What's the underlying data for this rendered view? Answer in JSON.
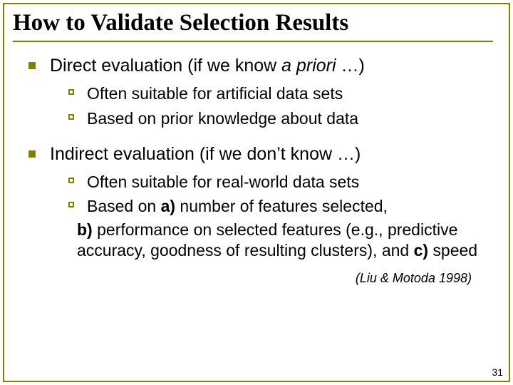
{
  "title": "How to Validate Selection Results",
  "topics": [
    {
      "heading_prefix": "Direct evaluation (if we know ",
      "heading_italic": "a priori",
      "heading_suffix": " …)",
      "subs": [
        {
          "line": "Often suitable for artificial data sets"
        },
        {
          "line": "Based on prior knowledge about data"
        }
      ]
    },
    {
      "heading_prefix": "Indirect evaluation (if we don’t know …)",
      "heading_italic": "",
      "heading_suffix": "",
      "subs": [
        {
          "line": "Often suitable for real-world data sets"
        },
        {
          "parts": [
            {
              "bold": false,
              "text": "Based on "
            },
            {
              "bold": true,
              "text": "a)"
            },
            {
              "bold": false,
              "text": " number of features selected, "
            }
          ],
          "cont": [
            [
              {
                "bold": true,
                "text": "b)"
              },
              {
                "bold": false,
                "text": " performance on selected features (e.g., predictive accuracy, goodness of resulting clusters), and "
              },
              {
                "bold": true,
                "text": "c)"
              },
              {
                "bold": false,
                "text": " speed"
              }
            ]
          ]
        }
      ]
    }
  ],
  "citation": "(Liu & Motoda 1998)",
  "page_number": "31"
}
